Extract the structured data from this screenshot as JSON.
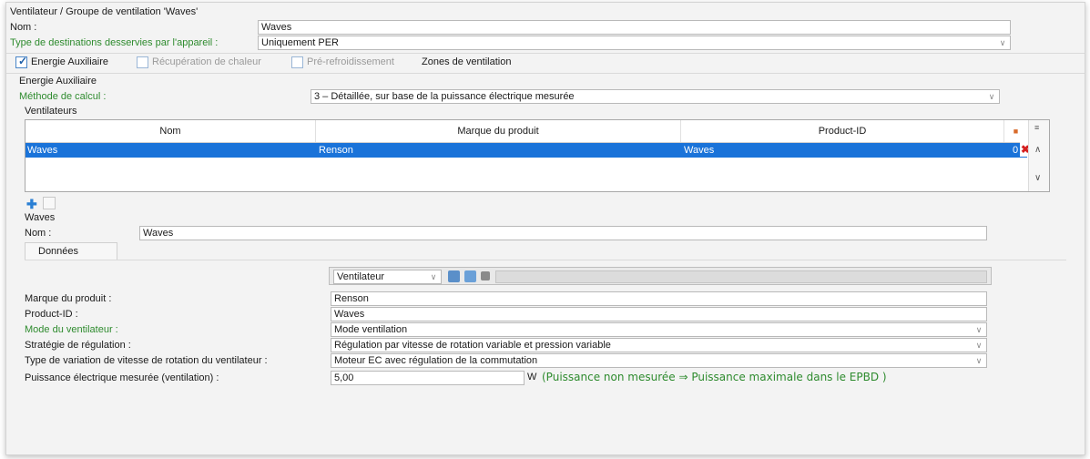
{
  "header": {
    "window_title": "Ventilateur / Groupe de ventilation 'Waves'",
    "name_label": "Nom :",
    "name_value": "Waves",
    "dest_label": "Type de destinations desservies par l'appareil :",
    "dest_value": "Uniquement PER"
  },
  "tabs": [
    {
      "label": "Energie Auxiliaire",
      "checked": true,
      "enabled": true
    },
    {
      "label": "Récupération de chaleur",
      "checked": false,
      "enabled": false
    },
    {
      "label": "Pré-refroidissement",
      "checked": false,
      "enabled": false
    },
    {
      "label": "Zones de ventilation"
    }
  ],
  "energy": {
    "section_title": "Energie Auxiliaire",
    "method_label": "Méthode de calcul :",
    "method_value": "3 – Détaillée, sur base de la puissance électrique mesurée",
    "fans_title": "Ventilateurs"
  },
  "table": {
    "columns": [
      "Nom",
      "Marque du produit",
      "Product-ID"
    ],
    "rows": [
      {
        "nom": "Waves",
        "marque": "Renson",
        "product_id": "Waves",
        "count": "0"
      }
    ]
  },
  "detail": {
    "title": "Waves",
    "name_label": "Nom :",
    "name_value": "Waves",
    "tab_label": "Données",
    "selector_value": "Ventilateur",
    "fields": [
      {
        "label": "Marque du produit :",
        "value": "Renson",
        "green": false,
        "dropdown": false
      },
      {
        "label": "Product-ID :",
        "value": "Waves",
        "green": false,
        "dropdown": false
      },
      {
        "label": "Mode du ventilateur :",
        "value": "Mode ventilation",
        "green": true,
        "dropdown": true
      },
      {
        "label": "Stratégie de régulation :",
        "value": "Régulation par vitesse de rotation variable et pression variable",
        "green": false,
        "dropdown": true
      },
      {
        "label": "Type de variation de vitesse de rotation du ventilateur :",
        "value": "Moteur EC avec régulation de la commutation",
        "green": false,
        "dropdown": true
      }
    ],
    "power_label": "Puissance électrique mesurée (ventilation) :",
    "power_value": "5,00",
    "power_unit": "W",
    "power_note": "(Puissance non mesurée ⇒ Puissance maximale dans le EPBD )"
  },
  "colors": {
    "green_label": "#2e8b2e",
    "selection": "#1a73d9",
    "delete_red": "#d42020"
  }
}
